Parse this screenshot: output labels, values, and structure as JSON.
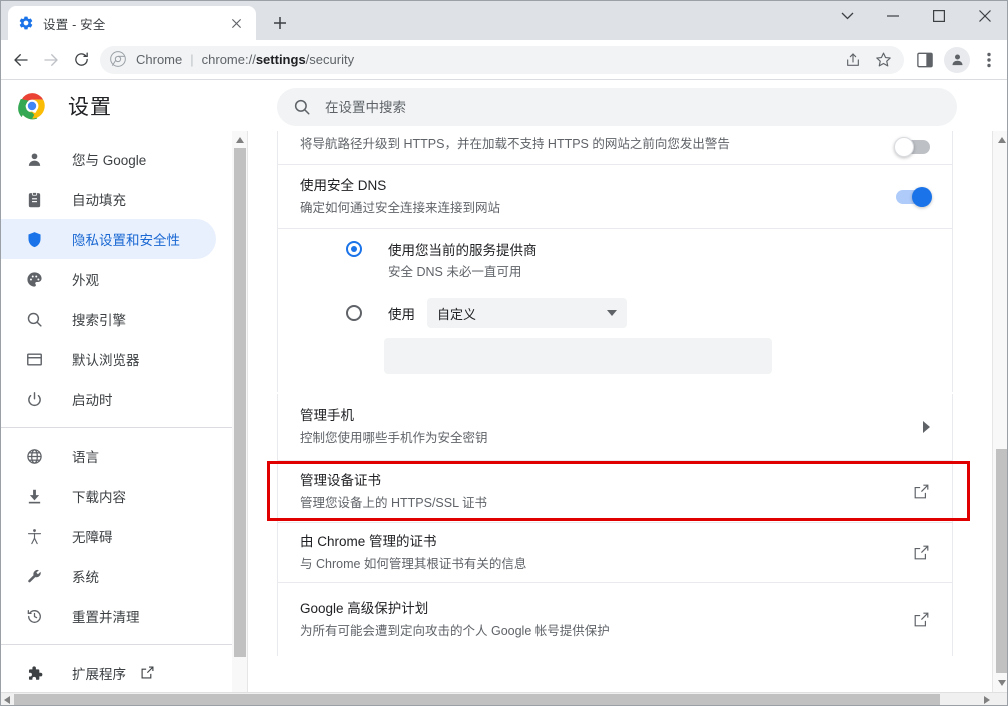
{
  "window": {
    "controls": [
      {
        "name": "tab-search-chevron",
        "glyph": "chevron-down"
      },
      {
        "name": "minimize",
        "glyph": "minimize"
      },
      {
        "name": "maximize",
        "glyph": "maximize"
      },
      {
        "name": "close",
        "glyph": "close"
      }
    ]
  },
  "tabstrip": {
    "tab_title": "设置 - 安全",
    "favicon": "gear-icon",
    "close_label": "✕",
    "newtab_label": "+"
  },
  "toolbar": {
    "back": "back-arrow",
    "forward": "forward-arrow",
    "reload": "reload-icon",
    "omnibox": {
      "scheme_label": "Chrome",
      "separator": "|",
      "url_prefix": "chrome://",
      "url_bold": "settings",
      "url_suffix": "/security",
      "security_icon": "chrome-logo-icon"
    },
    "right_buttons": [
      {
        "name": "share-icon"
      },
      {
        "name": "bookmark-star-icon"
      },
      {
        "name": "side-panel-icon"
      },
      {
        "name": "profile-avatar"
      },
      {
        "name": "more-vert-icon"
      }
    ]
  },
  "settings_header": {
    "logo": "chrome-logo-icon",
    "title": "设置"
  },
  "search": {
    "icon": "search-icon",
    "placeholder": "在设置中搜索",
    "value": ""
  },
  "sidebar": {
    "group1": [
      {
        "label": "您与 Google",
        "icon": "person-icon",
        "active": false
      },
      {
        "label": "自动填充",
        "icon": "clipboard-icon",
        "active": false
      },
      {
        "label": "隐私设置和安全性",
        "icon": "shield-icon",
        "active": true
      },
      {
        "label": "外观",
        "icon": "palette-icon",
        "active": false
      },
      {
        "label": "搜索引擎",
        "icon": "search-icon",
        "active": false
      },
      {
        "label": "默认浏览器",
        "icon": "browser-window-icon",
        "active": false
      },
      {
        "label": "启动时",
        "icon": "power-icon",
        "active": false
      }
    ],
    "group2": [
      {
        "label": "语言",
        "icon": "globe-icon",
        "active": false
      },
      {
        "label": "下载内容",
        "icon": "download-icon",
        "active": false
      },
      {
        "label": "无障碍",
        "icon": "accessibility-icon",
        "active": false
      },
      {
        "label": "系统",
        "icon": "wrench-icon",
        "active": false
      },
      {
        "label": "重置并清理",
        "icon": "history-restore-icon",
        "active": false
      }
    ],
    "group3": [
      {
        "label": "扩展程序",
        "icon": "puzzle-icon",
        "external": true,
        "external_icon": "external-link-icon"
      }
    ]
  },
  "main": {
    "https_row": {
      "description": "将导航路径升级到 HTTPS，并在加载不支持 HTTPS 的网站之前向您发出警告",
      "toggle_state": "off"
    },
    "dns": {
      "title": "使用安全 DNS",
      "subtitle": "确定如何通过安全连接来连接到网站",
      "toggle_state": "on",
      "options": [
        {
          "label": "使用您当前的服务提供商",
          "sublabel": "安全 DNS 未必一直可用",
          "selected": true
        },
        {
          "label": "使用",
          "selected": false,
          "dropdown_value": "自定义",
          "dropdown_caret": "▼",
          "custom_input_value": ""
        }
      ]
    },
    "rows": [
      {
        "title": "管理手机",
        "subtitle": "控制您使用哪些手机作为安全密钥",
        "action_icon": "chevron-right-icon",
        "highlighted": false
      },
      {
        "title": "管理设备证书",
        "subtitle": "管理您设备上的 HTTPS/SSL 证书",
        "action_icon": "external-link-icon",
        "highlighted": true
      },
      {
        "title": "由 Chrome 管理的证书",
        "subtitle": "与 Chrome 如何管理其根证书有关的信息",
        "action_icon": "external-link-icon",
        "highlighted": false
      },
      {
        "title": "Google 高级保护计划",
        "subtitle": "为所有可能会遭到定向攻击的个人 Google 帐号提供保护",
        "action_icon": "external-link-icon",
        "highlighted": false
      }
    ]
  },
  "colors": {
    "accent": "#1a73e8",
    "active_nav_bg": "#e8f0fe",
    "highlight_border": "#e00000",
    "tabstrip_bg": "#dee1e6",
    "field_bg": "#f1f3f4"
  }
}
